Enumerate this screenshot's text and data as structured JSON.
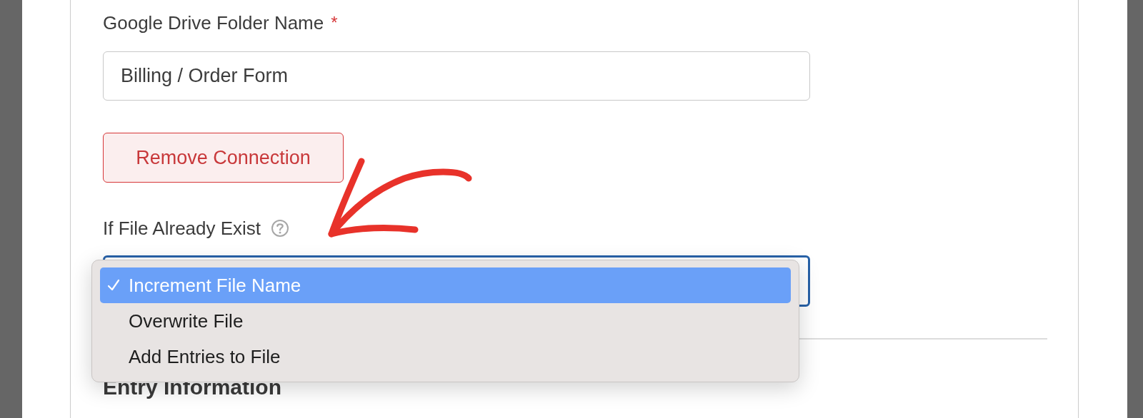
{
  "folder_field": {
    "label": "Google Drive Folder Name",
    "required": true,
    "required_mark": "*",
    "value": "Billing / Order Form"
  },
  "remove_button": {
    "label": "Remove Connection"
  },
  "exist_field": {
    "label": "If File Already Exist",
    "help": true,
    "options": [
      {
        "label": "Increment File Name",
        "selected": true
      },
      {
        "label": "Overwrite File",
        "selected": false
      },
      {
        "label": "Add Entries to File",
        "selected": false
      }
    ]
  },
  "section": {
    "title": "Entry Information"
  }
}
